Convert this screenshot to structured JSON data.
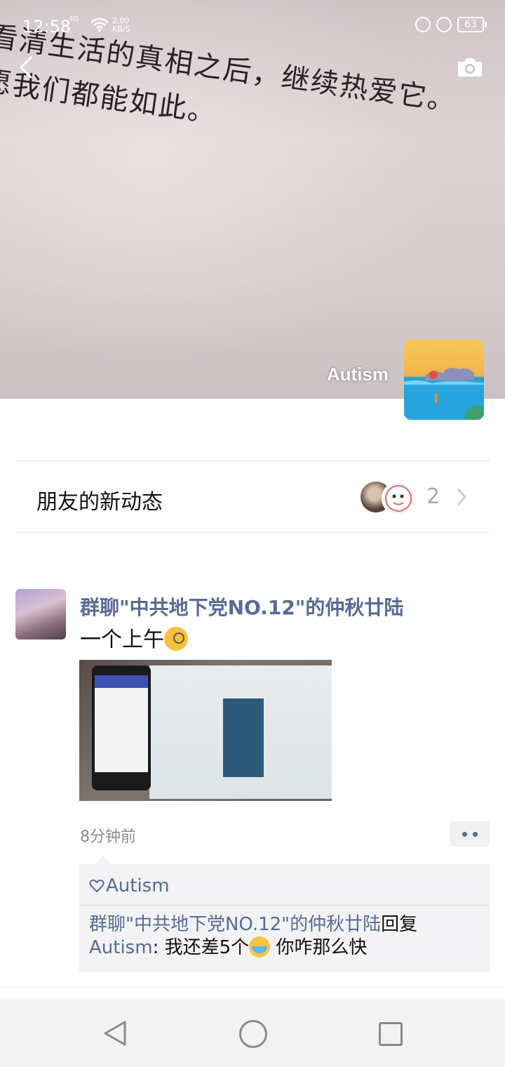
{
  "status_bar": {
    "time": "12:58",
    "network": "4G",
    "speed_value": "2.00",
    "speed_unit": "KB/S",
    "battery": "63"
  },
  "cover": {
    "line1": "看清生活的真相之后，继续热爱它。",
    "line2": "愿我们都能如此。"
  },
  "profile": {
    "name": "Autism"
  },
  "friends_updates": {
    "label": "朋友的新动态",
    "count": "2"
  },
  "post": {
    "author": "群聊\"中共地下党NO.12\"的仲秋廿陆",
    "text": "一个上午",
    "time": "8分钟前",
    "likes": "Autism",
    "comment": {
      "replier": "群聊\"中共地下党NO.12\"的仲秋廿陆",
      "reply_word": "回复",
      "target": "Autism",
      "separator": ": ",
      "text_before": "我还差5个",
      "text_after": " 你咋那么快"
    }
  },
  "colors": {
    "link": "#576b95",
    "timestamp": "#8c8c8c",
    "comment_bg": "#f3f3f5"
  },
  "icons": [
    "back-icon",
    "camera-icon",
    "chevron-right-icon",
    "heart-icon",
    "more-icon",
    "nav-back-icon",
    "nav-home-icon",
    "nav-recent-icon"
  ]
}
